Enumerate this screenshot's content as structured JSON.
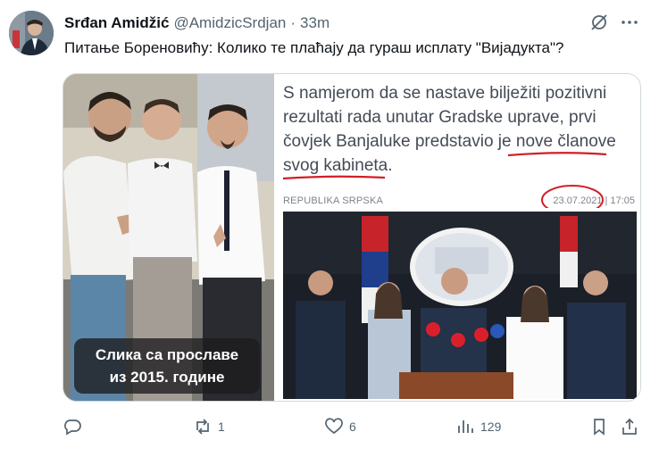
{
  "tweet": {
    "author_name": "Srđan Amidžić",
    "handle": "@AmidzicSrdjan",
    "separator": "·",
    "time": "33m",
    "text": "Питање Бореновићу: Колико те плаћају да гураш исплату \"Вијадукта\"?"
  },
  "media": {
    "left_caption_line1": "Слика са прославе",
    "left_caption_line2": "из 2015. године",
    "article_text_1": "S namjerom da se nastave bilježiti pozitivni rezultati rada unutar Gradske uprave, prvi čovjek Banjaluke predstavio je ",
    "article_highlight_1": "nove članove",
    "article_highlight_2": "svog kabineta",
    "article_text_2": ".",
    "source_label": "REPUBLIKA SRPSKA",
    "date": "23.07.2021",
    "date_sep": "|",
    "time": "17:05"
  },
  "actions": {
    "replies": "",
    "reposts": "1",
    "likes": "6",
    "views": "129"
  },
  "colors": {
    "underline": "#d21f26",
    "muted": "#536471"
  },
  "icons": [
    "grok-icon",
    "more-icon",
    "reply-icon",
    "repost-icon",
    "like-icon",
    "views-icon",
    "bookmark-icon",
    "share-icon"
  ]
}
